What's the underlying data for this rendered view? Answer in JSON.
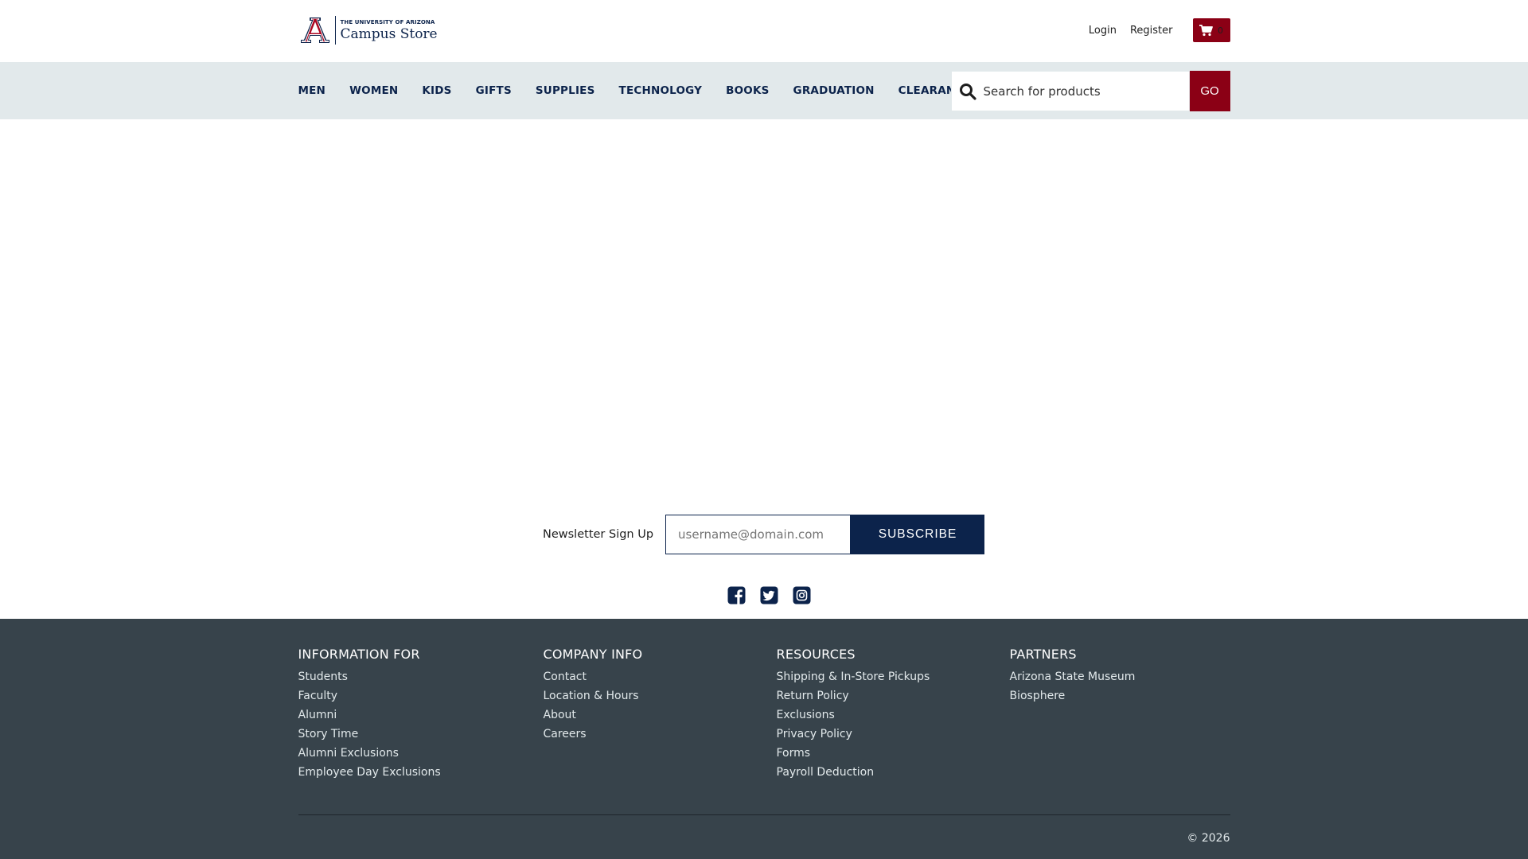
{
  "header": {
    "logo_small": "THE UNIVERSITY OF ARIZONA",
    "logo_big": "Campus Store",
    "login_label": "Login",
    "register_label": "Register",
    "cart_count": "0",
    "brand_color": "#8b0015",
    "navy_color": "#0c234b"
  },
  "nav": {
    "items": [
      "MEN",
      "WOMEN",
      "KIDS",
      "GIFTS",
      "SUPPLIES",
      "TECHNOLOGY",
      "BOOKS",
      "GRADUATION",
      "CLEARANCE"
    ]
  },
  "search": {
    "placeholder": "Search for products",
    "go_label": "GO"
  },
  "newsletter": {
    "label": "Newsletter Sign Up",
    "placeholder": "username@domain.com",
    "button_label": "SUBSCRIBE"
  },
  "social": {
    "icons": [
      "facebook-icon",
      "twitter-icon",
      "instagram-icon"
    ]
  },
  "footer": {
    "columns": [
      {
        "heading": "INFORMATION FOR",
        "links": [
          "Students",
          "Faculty",
          "Alumni",
          "Story Time",
          "Alumni Exclusions",
          "Employee Day Exclusions"
        ]
      },
      {
        "heading": "COMPANY INFO",
        "links": [
          "Contact",
          "Location & Hours",
          "About",
          "Careers"
        ]
      },
      {
        "heading": "RESOURCES",
        "links": [
          "Shipping & In-Store Pickups",
          "Return Policy",
          "Exclusions",
          "Privacy Policy",
          "Forms",
          "Payroll Deduction"
        ]
      },
      {
        "heading": "PARTNERS",
        "links": [
          "Arizona State Museum",
          "Biosphere"
        ]
      }
    ],
    "copyright": "© 2026",
    "background_color": "#37434b"
  }
}
